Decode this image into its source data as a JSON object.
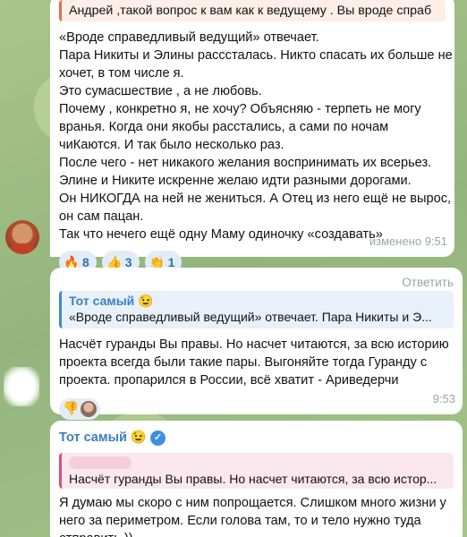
{
  "message1": {
    "quote_text": "Андрей ,такой вопрос к вам как к ведущему .  Вы вроде спраб",
    "lines": [
      "«Вроде справедливый ведущий» отвечает.",
      "Пара Никиты и Элины расссталась. Никто спасать их больше не",
      "хочет, в том числе я.",
      "Это сумасшествие , а не любовь.",
      "Почему , конкретно я, не хочу? Объясняю - терпеть не могу",
      "вранья. Когда они якобы расстались, а сами по ночам",
      "чиКаются. И так было несколько раз.",
      "После чего - нет никакого желания воспринимать их всерьез.",
      "Элине и Никите искренне желаю идти разными дорогами.",
      "Он НИКОГДА на ней не жениться. А Отец из него ещё не вырос,",
      "он сам пацан.",
      "Так что нечего ещё одну Маму одиночку «создавать»"
    ],
    "reactions": [
      {
        "emoji": "🔥",
        "count": "8"
      },
      {
        "emoji": "👍",
        "count": "3"
      },
      {
        "emoji": "👏",
        "count": "1"
      }
    ],
    "edited_time": "изменено 9:51"
  },
  "message2": {
    "reply_label": "Ответить",
    "quote_author": "Тот самый 😉",
    "quote_text": "«Вроде справедливый ведущий» отвечает. Пара Никиты и Э...",
    "lines": [
      "Насчёт гуранды Вы правы. Но насчет читаются, за всю историю",
      "проекта всегда были такие пары. Выгоняйте тогда Гуранду с",
      "проекта. пропарился в России, всё хватит - Ариведерчи"
    ],
    "reaction_emoji": "👎",
    "time": "9:53"
  },
  "message3": {
    "author": "Тот самый 😉",
    "quote_text": "Насчёт гуранды Вы правы. Но насчет читаются, за всю истор...",
    "lines": [
      "Я думаю мы скоро с ним попрощается. Слишком много жизни у",
      "него за периметром. Если голова там, то и тело нужно туда",
      "отправить ))"
    ]
  },
  "colors": {
    "link_blue": "#3a7fc1",
    "reaction_bg": "#e3ecf6",
    "quote1_accent": "#e26d4b",
    "quote2_accent": "#3a8ad0",
    "quote3_accent": "#d94f77",
    "meta_gray": "#9aa6a3"
  }
}
